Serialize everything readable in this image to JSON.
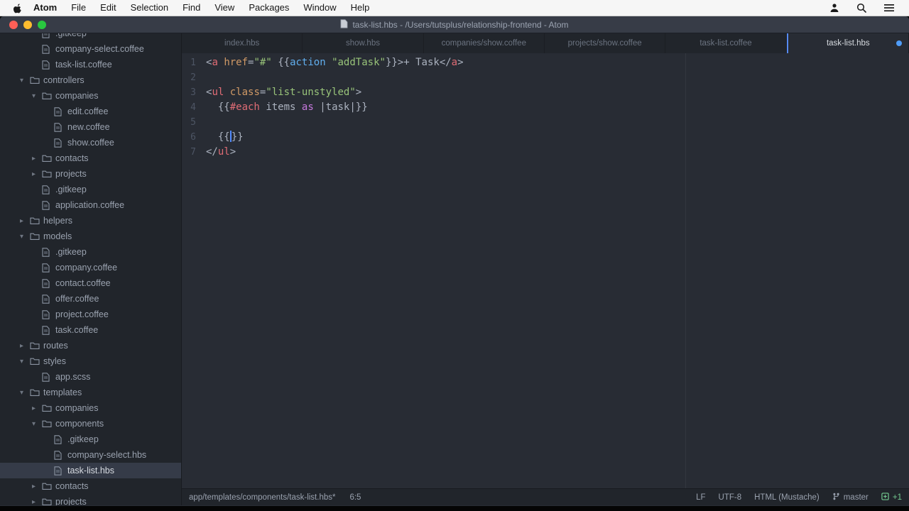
{
  "menu_bar": {
    "items": [
      "Atom",
      "File",
      "Edit",
      "Selection",
      "Find",
      "View",
      "Packages",
      "Window",
      "Help"
    ]
  },
  "title_bar": {
    "title": "task-list.hbs - /Users/tutsplus/relationship-frontend - Atom"
  },
  "sidebar": {
    "items": [
      {
        "label": ".gitkeep",
        "level": 2,
        "type": "file"
      },
      {
        "label": "company-select.coffee",
        "level": 2,
        "type": "file"
      },
      {
        "label": "task-list.coffee",
        "level": 2,
        "type": "file"
      },
      {
        "label": "controllers",
        "level": 1,
        "type": "folder-open"
      },
      {
        "label": "companies",
        "level": 2,
        "type": "folder-open"
      },
      {
        "label": "edit.coffee",
        "level": 3,
        "type": "file"
      },
      {
        "label": "new.coffee",
        "level": 3,
        "type": "file"
      },
      {
        "label": "show.coffee",
        "level": 3,
        "type": "file"
      },
      {
        "label": "contacts",
        "level": 2,
        "type": "folder-closed"
      },
      {
        "label": "projects",
        "level": 2,
        "type": "folder-closed"
      },
      {
        "label": ".gitkeep",
        "level": 2,
        "type": "file"
      },
      {
        "label": "application.coffee",
        "level": 2,
        "type": "file"
      },
      {
        "label": "helpers",
        "level": 1,
        "type": "folder-closed"
      },
      {
        "label": "models",
        "level": 1,
        "type": "folder-open"
      },
      {
        "label": ".gitkeep",
        "level": 2,
        "type": "file"
      },
      {
        "label": "company.coffee",
        "level": 2,
        "type": "file"
      },
      {
        "label": "contact.coffee",
        "level": 2,
        "type": "file"
      },
      {
        "label": "offer.coffee",
        "level": 2,
        "type": "file"
      },
      {
        "label": "project.coffee",
        "level": 2,
        "type": "file"
      },
      {
        "label": "task.coffee",
        "level": 2,
        "type": "file"
      },
      {
        "label": "routes",
        "level": 1,
        "type": "folder-closed"
      },
      {
        "label": "styles",
        "level": 1,
        "type": "folder-open"
      },
      {
        "label": "app.scss",
        "level": 2,
        "type": "file"
      },
      {
        "label": "templates",
        "level": 1,
        "type": "folder-open"
      },
      {
        "label": "companies",
        "level": 2,
        "type": "folder-closed"
      },
      {
        "label": "components",
        "level": 2,
        "type": "folder-open"
      },
      {
        "label": ".gitkeep",
        "level": 3,
        "type": "file"
      },
      {
        "label": "company-select.hbs",
        "level": 3,
        "type": "file"
      },
      {
        "label": "task-list.hbs",
        "level": 3,
        "type": "file",
        "selected": true
      },
      {
        "label": "contacts",
        "level": 2,
        "type": "folder-closed"
      },
      {
        "label": "projects",
        "level": 2,
        "type": "folder-closed"
      }
    ]
  },
  "tabs": [
    {
      "label": "index.hbs"
    },
    {
      "label": "show.hbs"
    },
    {
      "label": "companies/show.coffee"
    },
    {
      "label": "projects/show.coffee"
    },
    {
      "label": "task-list.coffee"
    },
    {
      "label": "task-list.hbs",
      "active": true,
      "modified": true
    }
  ],
  "editor": {
    "lines": [
      {
        "num": 1,
        "tokens": [
          {
            "t": "<",
            "c": "punc"
          },
          {
            "t": "a",
            "c": "tag"
          },
          {
            "t": " ",
            "c": "plain"
          },
          {
            "t": "href",
            "c": "attr"
          },
          {
            "t": "=",
            "c": "punc"
          },
          {
            "t": "\"#\"",
            "c": "str"
          },
          {
            "t": " ",
            "c": "plain"
          },
          {
            "t": "{{",
            "c": "punc"
          },
          {
            "t": "action",
            "c": "fn"
          },
          {
            "t": " ",
            "c": "plain"
          },
          {
            "t": "\"addTask\"",
            "c": "str"
          },
          {
            "t": "}}",
            "c": "punc"
          },
          {
            "t": ">",
            "c": "punc"
          },
          {
            "t": "+ Task",
            "c": "plain"
          },
          {
            "t": "</",
            "c": "punc"
          },
          {
            "t": "a",
            "c": "tag"
          },
          {
            "t": ">",
            "c": "punc"
          }
        ]
      },
      {
        "num": 2,
        "tokens": []
      },
      {
        "num": 3,
        "tokens": [
          {
            "t": "<",
            "c": "punc"
          },
          {
            "t": "ul",
            "c": "tag"
          },
          {
            "t": " ",
            "c": "plain"
          },
          {
            "t": "class",
            "c": "attr"
          },
          {
            "t": "=",
            "c": "punc"
          },
          {
            "t": "\"list-unstyled\"",
            "c": "str"
          },
          {
            "t": ">",
            "c": "punc"
          }
        ]
      },
      {
        "num": 4,
        "tokens": [
          {
            "t": "  ",
            "c": "plain"
          },
          {
            "t": "{{",
            "c": "punc"
          },
          {
            "t": "#each",
            "c": "tag"
          },
          {
            "t": " ",
            "c": "plain"
          },
          {
            "t": "items",
            "c": "plain"
          },
          {
            "t": " ",
            "c": "plain"
          },
          {
            "t": "as",
            "c": "kw"
          },
          {
            "t": " ",
            "c": "plain"
          },
          {
            "t": "|",
            "c": "punc"
          },
          {
            "t": "task",
            "c": "plain"
          },
          {
            "t": "|",
            "c": "punc"
          },
          {
            "t": "}}",
            "c": "punc"
          }
        ]
      },
      {
        "num": 5,
        "tokens": []
      },
      {
        "num": 6,
        "tokens": [
          {
            "t": "  ",
            "c": "plain"
          },
          {
            "t": "{{",
            "c": "punc"
          },
          {
            "t": "",
            "c": "cursor"
          },
          {
            "t": "}}",
            "c": "punc"
          }
        ]
      },
      {
        "num": 7,
        "tokens": [
          {
            "t": "</",
            "c": "punc"
          },
          {
            "t": "ul",
            "c": "tag"
          },
          {
            "t": ">",
            "c": "punc"
          }
        ]
      }
    ]
  },
  "status_bar": {
    "path": "app/templates/components/task-list.hbs*",
    "cursor_position": "6:5",
    "eol": "LF",
    "encoding": "UTF-8",
    "grammar": "HTML (Mustache)",
    "branch": "master",
    "diff_added": "+1"
  },
  "colors": {
    "accent_blue": "#528bff",
    "diff_green": "#73c990",
    "editor_bg": "#282c34",
    "chrome_bg": "#21252b"
  }
}
